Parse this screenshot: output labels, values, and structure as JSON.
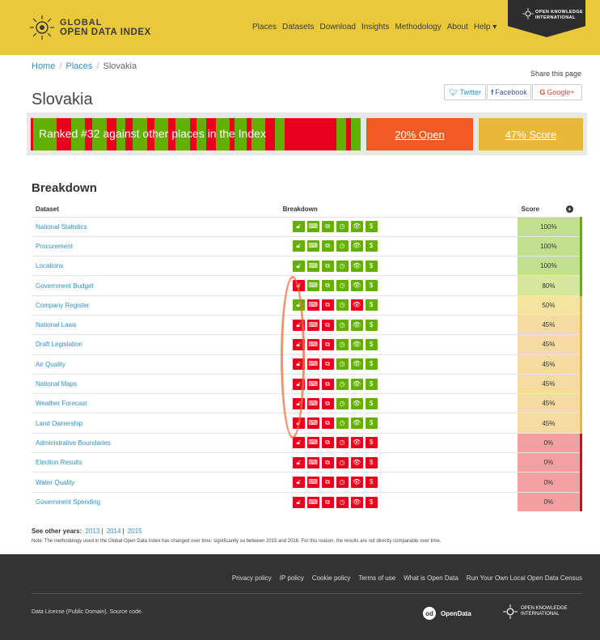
{
  "brand": {
    "line1": "GLOBAL",
    "line2": "OPEN DATA INDEX",
    "ok_line1": "OPEN KNOWLEDGE",
    "ok_line2": "INTERNATIONAL"
  },
  "nav": [
    "Places",
    "Datasets",
    "Download",
    "Insights",
    "Methodology",
    "About",
    "Help ▾"
  ],
  "breadcrumb": {
    "home": "Home",
    "places": "Places",
    "current": "Slovakia"
  },
  "share": {
    "label": "Share this page",
    "twitter": "Twitter",
    "facebook": "Facebook",
    "google": "Google+"
  },
  "title": "Slovakia",
  "rank": {
    "text": "Ranked #32 against other places in the Index",
    "open": "20% Open",
    "score": "47% Score"
  },
  "colors": {
    "green": "#63b000",
    "red": "#e8001c",
    "header": "#e9c93a",
    "open": "#f15a24",
    "score": "#e9b83a"
  },
  "breakdown": {
    "title": "Breakdown",
    "headers": {
      "dataset": "Dataset",
      "breakdown": "Breakdown",
      "score": "Score"
    },
    "icons": [
      "lock-icon",
      "keyboard-icon",
      "copy-icon",
      "clock-icon",
      "eye-icon",
      "dollar-icon"
    ],
    "rows": [
      {
        "name": "National Statistics",
        "score": "100%",
        "flags": [
          1,
          1,
          1,
          1,
          1,
          1
        ],
        "bg": "#c3df90",
        "edge": "#63b000"
      },
      {
        "name": "Procurement",
        "score": "100%",
        "flags": [
          1,
          1,
          1,
          1,
          1,
          1
        ],
        "bg": "#c3df90",
        "edge": "#63b000"
      },
      {
        "name": "Locations",
        "score": "100%",
        "flags": [
          1,
          1,
          1,
          1,
          1,
          1
        ],
        "bg": "#c3df90",
        "edge": "#63b000"
      },
      {
        "name": "Government Budget",
        "score": "80%",
        "flags": [
          0,
          1,
          1,
          1,
          1,
          1
        ],
        "bg": "#d6e69d",
        "edge": "#63b000"
      },
      {
        "name": "Company Register",
        "score": "50%",
        "flags": [
          1,
          0,
          0,
          1,
          0,
          1
        ],
        "bg": "#f5e4a0",
        "edge": "#e9b83a"
      },
      {
        "name": "National Laws",
        "score": "45%",
        "flags": [
          0,
          0,
          0,
          1,
          1,
          1
        ],
        "bg": "#f6dba0",
        "edge": "#e9b83a"
      },
      {
        "name": "Draft Legislation",
        "score": "45%",
        "flags": [
          0,
          0,
          0,
          1,
          1,
          1
        ],
        "bg": "#f6dba0",
        "edge": "#e9b83a"
      },
      {
        "name": "Air Quality",
        "score": "45%",
        "flags": [
          0,
          0,
          0,
          1,
          1,
          1
        ],
        "bg": "#f6dba0",
        "edge": "#e9b83a"
      },
      {
        "name": "National Maps",
        "score": "45%",
        "flags": [
          0,
          0,
          0,
          1,
          1,
          1
        ],
        "bg": "#f6dba0",
        "edge": "#e9b83a"
      },
      {
        "name": "Weather Forecast",
        "score": "45%",
        "flags": [
          0,
          0,
          0,
          1,
          1,
          1
        ],
        "bg": "#f6dba0",
        "edge": "#e9b83a"
      },
      {
        "name": "Land Ownership",
        "score": "45%",
        "flags": [
          0,
          0,
          0,
          1,
          1,
          1
        ],
        "bg": "#f6dba0",
        "edge": "#e9b83a"
      },
      {
        "name": "Administrative Boundaries",
        "score": "0%",
        "flags": [
          0,
          0,
          0,
          0,
          0,
          0
        ],
        "bg": "#f4a0a0",
        "edge": "#e8001c"
      },
      {
        "name": "Election Results",
        "score": "0%",
        "flags": [
          0,
          0,
          0,
          0,
          0,
          0
        ],
        "bg": "#f4a0a0",
        "edge": "#e8001c"
      },
      {
        "name": "Water Quality",
        "score": "0%",
        "flags": [
          0,
          0,
          0,
          0,
          0,
          0
        ],
        "bg": "#f4a0a0",
        "edge": "#e8001c"
      },
      {
        "name": "Government Spending",
        "score": "0%",
        "flags": [
          0,
          0,
          0,
          0,
          0,
          0
        ],
        "bg": "#f4a0a0",
        "edge": "#e8001c"
      }
    ]
  },
  "years": {
    "label": "See other years:",
    "list": [
      "2013",
      "2014",
      "2015"
    ]
  },
  "note": "Note: The methodology used in the Global Open Data Index has changed over time; significantly so between 2015 and 2016. For this reason, the results are not directly comparable over time.",
  "footer": {
    "links": [
      "Privacy policy",
      "IP policy",
      "Cookie policy",
      "Terms of use",
      "What is Open Data",
      "Run Your Own Local Open Data Census"
    ],
    "license": "Data License (Public Domain). Source code.",
    "od_logo": "OpenData",
    "ok_line1": "OPEN KNOWLEDGE",
    "ok_line2": "INTERNATIONAL"
  }
}
